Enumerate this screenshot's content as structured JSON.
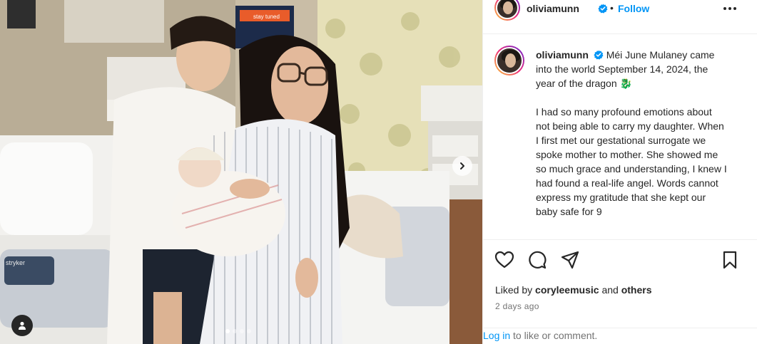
{
  "post": {
    "username": "oliviamunn",
    "follow_label": "Follow",
    "separator": "•",
    "more_icon": "more-horizontal-icon",
    "verified_icon": "verified-badge-icon",
    "caption": {
      "username": "oliviamunn",
      "first_line": "Méi June Mulaney came into the world September 14, 2024, the year of the dragon 🐉",
      "second_paragraph": "I had so many profound emotions about not being able to carry my daughter. When I first met our gestational surrogate we spoke mother to mother. She showed me so much grace and understanding, I knew I had found a real-life angel. Words cannot express my gratitude that she kept our baby safe for 9"
    },
    "liked_by_prefix": "Liked by",
    "liked_by_user": "coryleemusic",
    "liked_by_and": "and",
    "liked_by_others": "others",
    "time_ago": "2 days ago",
    "login_link": "Log in",
    "login_rest": "to like or comment."
  },
  "media": {
    "carousel_total": 4,
    "carousel_active": 1,
    "next_icon": "chevron-right-icon",
    "tag_icon": "user-tag-icon",
    "monitor_text": "stay tuned",
    "bed_brand": "stryker"
  },
  "icons": {
    "like": "heart-icon",
    "comment": "comment-icon",
    "share": "share-icon",
    "save": "bookmark-icon"
  },
  "colors": {
    "accent": "#0095f6",
    "text": "#262626",
    "muted": "#737373",
    "border": "#efefef"
  }
}
